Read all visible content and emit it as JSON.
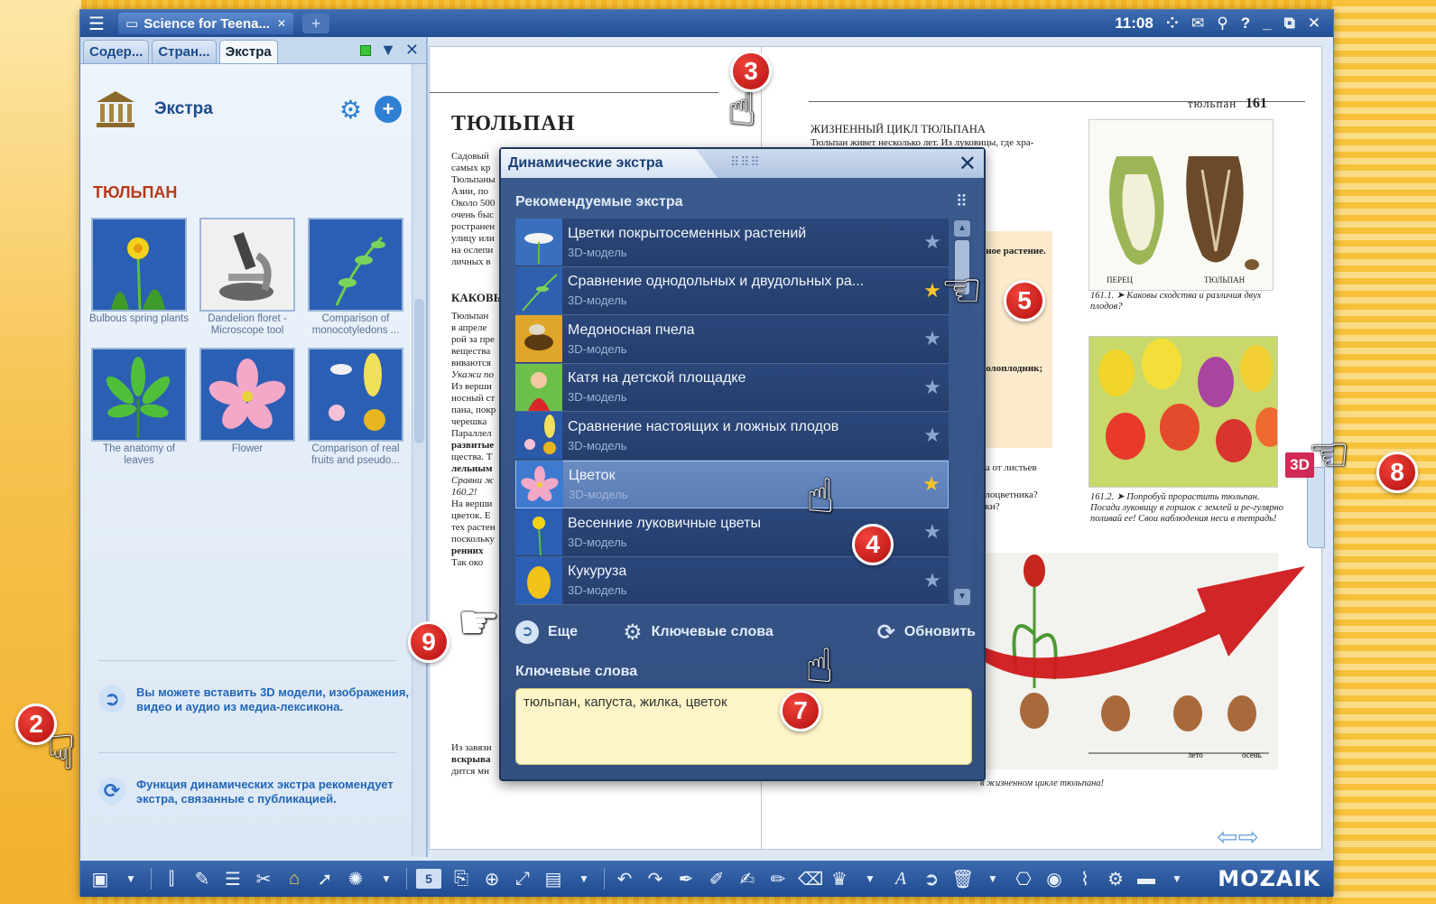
{
  "window": {
    "doc_tab": "Science for Teena...",
    "time": "11:08"
  },
  "left_panel": {
    "tabs": [
      "Содер...",
      "Стран...",
      "Экстра"
    ],
    "header_title": "Экстра",
    "section_title": "ТЮЛЬПАН",
    "thumbnails": [
      {
        "caption": "Bulbous spring plants"
      },
      {
        "caption": "Dandelion floret - Microscope tool"
      },
      {
        "caption": "Comparison of monocotyledons ..."
      },
      {
        "caption": "The anatomy of leaves"
      },
      {
        "caption": "Flower"
      },
      {
        "caption": "Comparison of real fruits and pseudo..."
      }
    ],
    "info1": "Вы можете вставить 3D модели, изображения, видео и аудио из медиа-лексикона.",
    "info2": "Функция динамических экстра рекомендует экстра, связанные с публикацией."
  },
  "book": {
    "left_title": "ТЮЛЬПАН",
    "page_header": "тюльпан",
    "page_number": "161",
    "lifecycle_title": "ЖИЗНЕННЫЙ ЦИКЛ ТЮЛЬПАНА",
    "lifecycle_text": "Тюльпан живет несколько лет. Из луковицы, где хра-",
    "fig_caption1": "161.1. ➤ Каковы сходства и различия двух плодов?",
    "fig_caption2": "161.2. ➤ Попробуй прорастить тюльпан. Посади луковицу в горшок с землей и ре-гулярно поливай ее! Свои наблюдения неси в тетрадь!",
    "label_pepper": "ПЕРЕЦ",
    "label_tulip": "ТЮЛЬПАН",
    "left_subtitle": "КАКОВЫ"
  },
  "dialog": {
    "title": "Динамические экстра",
    "section_recommended": "Рекомендуемые экстра",
    "items": [
      {
        "title": "Цветки покрытосеменных растений",
        "type": "3D-модель",
        "starred": false
      },
      {
        "title": "Сравнение однодольных и двудольных ра...",
        "type": "3D-модель",
        "starred": true
      },
      {
        "title": "Медоносная пчела",
        "type": "3D-модель",
        "starred": false
      },
      {
        "title": "Катя на детской площадке",
        "type": "3D-модель",
        "starred": false
      },
      {
        "title": "Сравнение настоящих и ложных плодов",
        "type": "3D-модель",
        "starred": false
      },
      {
        "title": "Цветок",
        "type": "3D-модель",
        "starred": true
      },
      {
        "title": "Весенние луковичные цветы",
        "type": "3D-модель",
        "starred": false
      },
      {
        "title": "Кукуруза",
        "type": "3D-модель",
        "starred": false
      }
    ],
    "more_label": "Еще",
    "keywords_label": "Ключевые слова",
    "refresh_label": "Обновить",
    "keywords_section": "Ключевые слова",
    "keywords_value": "тюльпан, капуста, жилка, цветок"
  },
  "bottombar": {
    "page_num": "5",
    "brand": "MOZAIK"
  },
  "badge": "3D",
  "callouts": [
    "2",
    "3",
    "4",
    "5",
    "7",
    "8",
    "9"
  ]
}
